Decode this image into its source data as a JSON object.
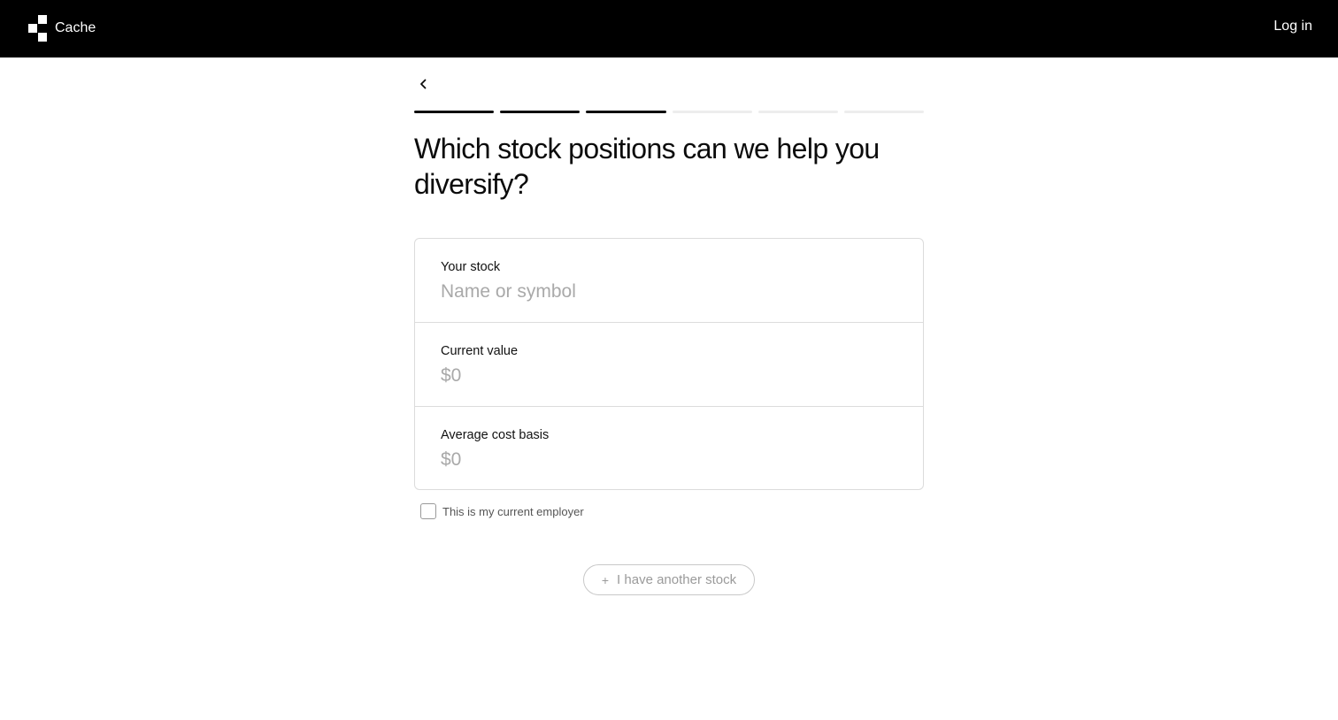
{
  "header": {
    "brand_name": "Cache",
    "login_label": "Log in",
    "logo_icon": "cache-logo-icon",
    "background_color": "#000000"
  },
  "navigation": {
    "back_icon": "chevron-left-icon"
  },
  "progress": {
    "total_steps": 6,
    "completed_steps": 3
  },
  "main": {
    "title": "Which stock positions can we help you diversify?",
    "fields": [
      {
        "label": "Your stock",
        "placeholder": "Name or symbol",
        "value": ""
      },
      {
        "label": "Current value",
        "placeholder": "$0",
        "value": ""
      },
      {
        "label": "Average cost basis",
        "placeholder": "$0",
        "value": ""
      }
    ],
    "employer_checkbox": {
      "label": "This is my current employer",
      "checked": false
    },
    "add_stock_button": {
      "icon": "plus-icon",
      "label": "I have another stock"
    }
  }
}
